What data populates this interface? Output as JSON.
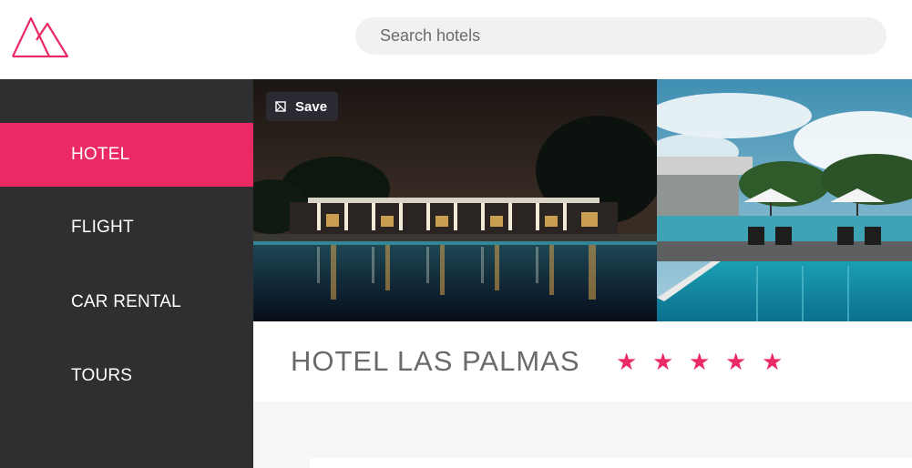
{
  "header": {
    "logo_icon": "mountains-logo-icon",
    "search_placeholder": "Search hotels",
    "accent_color": "#eb2a65"
  },
  "sidebar": {
    "items": [
      {
        "label": "HOTEL",
        "active": true
      },
      {
        "label": "FLIGHT",
        "active": false
      },
      {
        "label": "CAR RENTAL",
        "active": false
      },
      {
        "label": "TOURS",
        "active": false
      }
    ]
  },
  "gallery": {
    "save_label": "Save",
    "save_icon": "bookmark-icon"
  },
  "hotel": {
    "name": "HOTEL LAS PALMAS",
    "stars": [
      "★",
      "★",
      "★",
      "★",
      "★"
    ],
    "rating": 5
  }
}
